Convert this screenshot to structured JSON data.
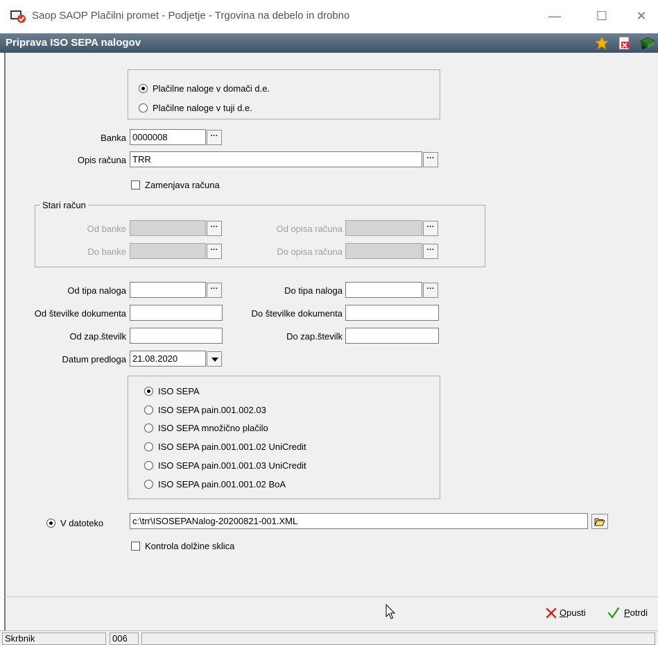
{
  "window": {
    "title": "Saop SAOP Plačilni promet - Podjetje - Trgovina na debelo in drobno",
    "minimize": "—",
    "maximize": "☐",
    "close": "✕"
  },
  "panel": {
    "title": "Priprava ISO SEPA nalogov"
  },
  "domain_options": [
    {
      "label": "Plačilne naloge v domači d.e.",
      "selected": true
    },
    {
      "label": "Plačilne naloge v tuji d.e.",
      "selected": false
    }
  ],
  "bank": {
    "label": "Banka",
    "value": "0000008",
    "button": "···"
  },
  "account_desc": {
    "label": "Opis računa",
    "value": "TRR",
    "button": "···"
  },
  "replace_account": {
    "label": "Zamenjava računa",
    "checked": false
  },
  "old_account": {
    "legend": "Stari račun",
    "from_bank": "Od banke",
    "to_bank": "Do banke",
    "from_desc": "Od opisa računa",
    "to_desc": "Do opisa računa"
  },
  "filters": {
    "from_type": "Od tipa naloga",
    "to_type": "Do tipa naloga",
    "from_doc": "Od številke dokumenta",
    "to_doc": "Do številke dokumenta",
    "from_seq": "Od zap.številk",
    "to_seq": "Do zap.številk",
    "date_label": "Datum predloga",
    "date_value": "21.08.2020"
  },
  "format_options": [
    {
      "label": "ISO SEPA",
      "selected": true
    },
    {
      "label": "ISO SEPA pain.001.002.03",
      "selected": false
    },
    {
      "label": "ISO SEPA množično plačilo",
      "selected": false
    },
    {
      "label": "ISO SEPA pain.001.001.02 UniCredit",
      "selected": false
    },
    {
      "label": "ISO SEPA pain.001.001.03 UniCredit",
      "selected": false
    },
    {
      "label": "ISO SEPA pain.001.001.02 BoA",
      "selected": false
    }
  ],
  "output": {
    "label": "V datoteko",
    "path": "c:\\trr\\ISOSEPANalog-20200821-001.XML"
  },
  "check_ref_length": {
    "label": "Kontrola dolžine sklica",
    "checked": false
  },
  "buttons": {
    "cancel_accel": "O",
    "cancel_rest": "pusti",
    "confirm_accel": "P",
    "confirm_rest": "otrdi"
  },
  "status": {
    "user": "Skrbnik",
    "code": "006"
  },
  "colors": {
    "header": "#3f5366",
    "cancel": "#d4241c",
    "confirm": "#3a9a1a"
  }
}
